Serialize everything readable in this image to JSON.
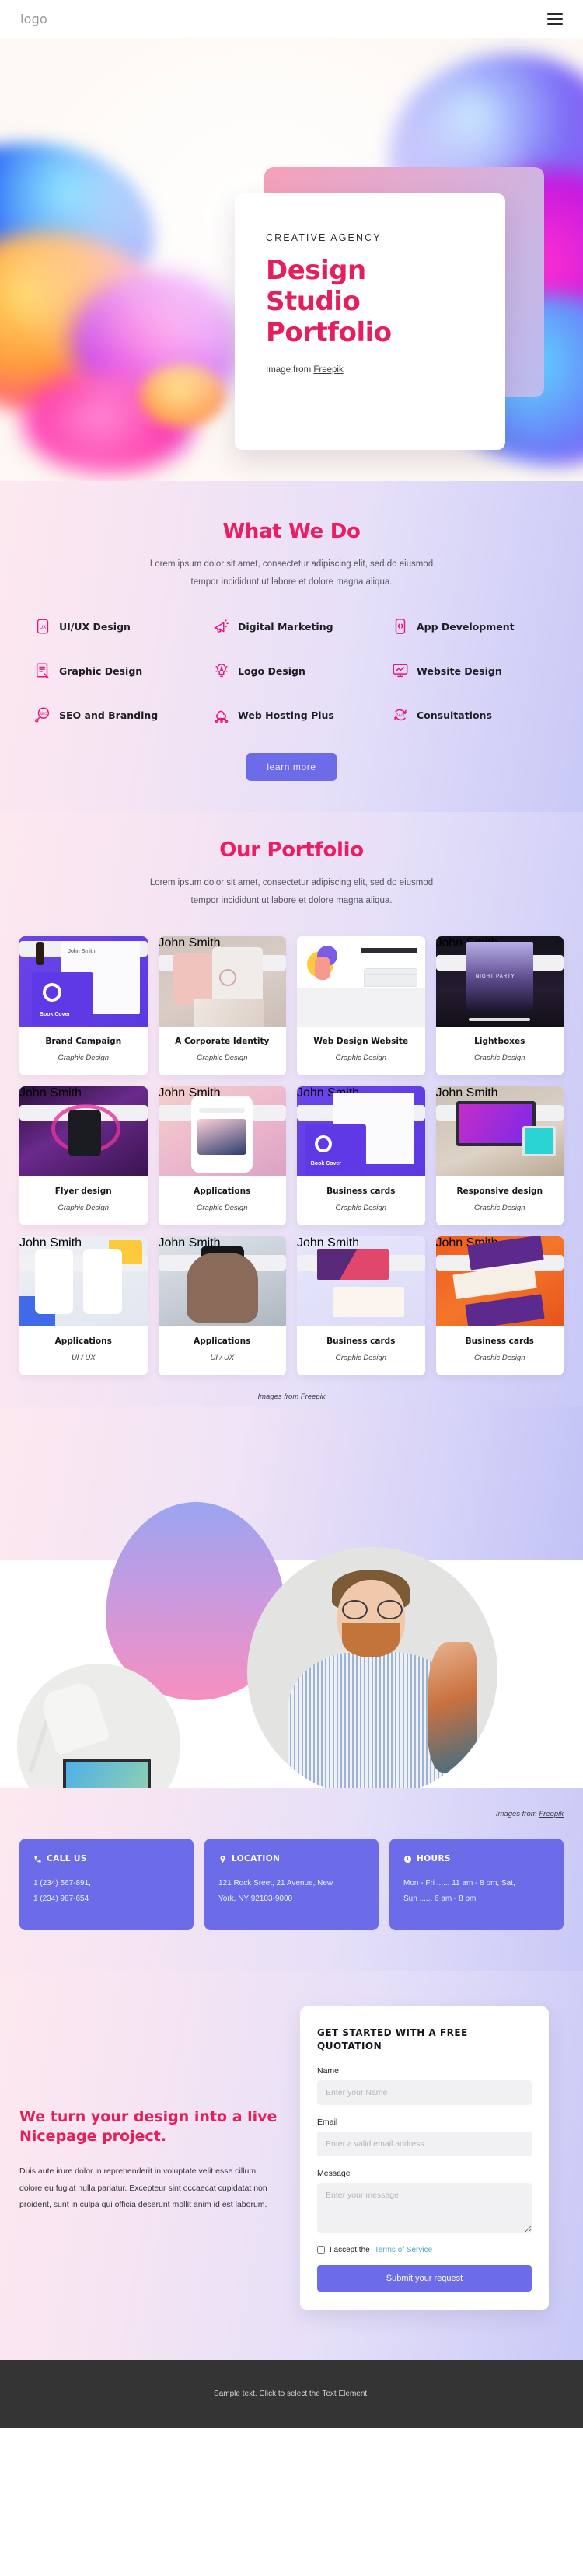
{
  "header": {
    "logo": "logo",
    "menu_icon": "hamburger-menu"
  },
  "hero": {
    "eyebrow": "CREATIVE AGENCY",
    "title_lines": [
      "Design",
      "Studio",
      "Portfolio"
    ],
    "credit_prefix": "Image from ",
    "credit_link": "Freepik"
  },
  "services": {
    "title": "What We Do",
    "subtitle": "Lorem ipsum dolor sit amet, consectetur adipiscing elit, sed do eiusmod tempor incididunt ut labore et dolore magna aliqua.",
    "items": [
      {
        "label": "UI/UX Design",
        "icon": "ux-card-icon"
      },
      {
        "label": "Digital Marketing",
        "icon": "megaphone-icon"
      },
      {
        "label": "App Development",
        "icon": "phone-code-icon"
      },
      {
        "label": "Graphic Design",
        "icon": "document-pen-icon"
      },
      {
        "label": "Logo Design",
        "icon": "lightbulb-pen-icon"
      },
      {
        "label": "Website Design",
        "icon": "monitor-chart-icon"
      },
      {
        "label": "SEO and Branding",
        "icon": "seo-magnifier-icon"
      },
      {
        "label": "Web Hosting Plus",
        "icon": "cloud-network-icon"
      },
      {
        "label": "Consultations",
        "icon": "24-7-icon"
      }
    ],
    "button": "learn more"
  },
  "portfolio": {
    "title": "Our Portfolio",
    "subtitle": "Lorem ipsum dolor sit amet, consectetur adipiscing elit, sed do eiusmod tempor incididunt ut labore et dolore magna aliqua.",
    "items": [
      {
        "name": "Brand Campaign",
        "category": "Graphic Design",
        "art": "art-brand"
      },
      {
        "name": "A Corporate Identity",
        "category": "Graphic Design",
        "art": "art-corp"
      },
      {
        "name": "Web Design Website",
        "category": "Graphic Design",
        "art": "art-web"
      },
      {
        "name": "Lightboxes",
        "category": "Graphic Design",
        "art": "art-light"
      },
      {
        "name": "Flyer design",
        "category": "Graphic Design",
        "art": "art-flyer"
      },
      {
        "name": "Applications",
        "category": "Graphic Design",
        "art": "art-app1"
      },
      {
        "name": "Business cards",
        "category": "Graphic Design",
        "art": "art-bc1"
      },
      {
        "name": "Responsive design",
        "category": "Graphic Design",
        "art": "art-resp"
      },
      {
        "name": "Applications",
        "category": "UI / UX",
        "art": "art-app2"
      },
      {
        "name": "Applications",
        "category": "UI / UX",
        "art": "art-app3"
      },
      {
        "name": "Business cards",
        "category": "Graphic Design",
        "art": "art-bc2"
      },
      {
        "name": "Business cards",
        "category": "Graphic Design",
        "art": "art-bc3"
      }
    ],
    "credit_prefix": "Images from ",
    "credit_link": "Freepik"
  },
  "photos": {
    "credit_prefix": "Images from ",
    "credit_link": "Freepik"
  },
  "contacts": [
    {
      "title": "CALL US",
      "icon": "phone-icon",
      "lines": [
        "1 (234) 567-891,",
        "1 (234) 987-654"
      ]
    },
    {
      "title": "LOCATION",
      "icon": "map-pin-icon",
      "lines": [
        "121 Rock Sreet, 21 Avenue, New",
        "York, NY 92103-9000"
      ]
    },
    {
      "title": "HOURS",
      "icon": "clock-icon",
      "lines": [
        "Mon - Fri ...... 11 am - 8 pm, Sat,",
        "Sun  ...... 6 am - 8 pm"
      ]
    }
  ],
  "cta": {
    "title": "We turn your design into a live Nicepage project.",
    "text": "Duis aute irure dolor in reprehenderit in voluptate velit esse cillum dolore eu fugiat nulla pariatur. Excepteur sint occaecat cupidatat non proident, sunt in culpa qui officia deserunt mollit anim id est laborum."
  },
  "form": {
    "title": "GET STARTED WITH A FREE QUOTATION",
    "name_label": "Name",
    "name_placeholder": "Enter your Name",
    "name_value": "",
    "email_label": "Email",
    "email_placeholder": "Enter a valid email address",
    "email_value": "",
    "message_label": "Message",
    "message_placeholder": "Enter your message",
    "message_value": "",
    "accept_text": "I accept the ",
    "terms_link": "Terms of Service",
    "submit_label": "Submit your request"
  },
  "footer": {
    "text": "Sample text. Click to select the Text Element."
  },
  "colors": {
    "accent_pink": "#e51f5c",
    "accent_magenta": "#e5187f",
    "purple": "#6c6ce8",
    "footer_bg": "#343434",
    "link_teal": "#4da3c9"
  }
}
